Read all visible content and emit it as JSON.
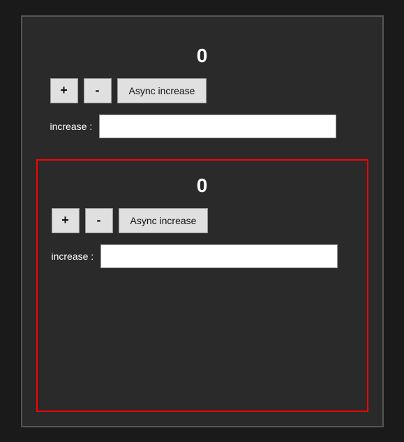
{
  "section1": {
    "count": "0",
    "plus_label": "+",
    "minus_label": "-",
    "async_button_label": "Async increase",
    "increase_label": "increase :",
    "input_value": "",
    "input_placeholder": ""
  },
  "section2": {
    "count": "0",
    "plus_label": "+",
    "minus_label": "-",
    "async_button_label": "Async increase",
    "increase_label": "increase :",
    "input_value": "",
    "input_placeholder": ""
  },
  "colors": {
    "outer_border": "#555555",
    "highlight_border": "red",
    "background": "#2a2a2a",
    "text": "#ffffff",
    "button_bg": "#e0e0e0"
  }
}
